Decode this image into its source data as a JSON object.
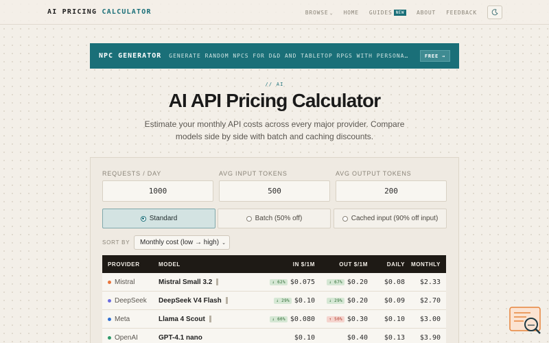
{
  "header": {
    "logo_main": "AI PRICING",
    "logo_accent": "CALCULATOR",
    "nav": {
      "browse": "BROWSE",
      "home": "HOME",
      "guides": "GUIDES",
      "guides_badge": "NEW",
      "about": "ABOUT",
      "feedback": "FEEDBACK"
    }
  },
  "banner": {
    "title": "NPC GENERATOR",
    "description": "GENERATE RANDOM NPCS FOR D&D AND TABLETOP RPGS WITH PERSONA…",
    "cta": "FREE →"
  },
  "hero": {
    "eyebrow": "// AI",
    "title": "AI API Pricing Calculator",
    "subtitle": "Estimate your monthly API costs across every major provider. Compare models side by side with batch and caching discounts."
  },
  "inputs": {
    "requests_label": "REQUESTS / DAY",
    "requests_value": "1000",
    "input_tokens_label": "AVG INPUT TOKENS",
    "input_tokens_value": "500",
    "output_tokens_label": "AVG OUTPUT TOKENS",
    "output_tokens_value": "200"
  },
  "modes": {
    "standard": "Standard",
    "batch": "Batch (50% off)",
    "cached": "Cached input (90% off input)",
    "selected": "standard"
  },
  "sort": {
    "label": "SORT BY",
    "selected": "Monthly cost (low → high)"
  },
  "table": {
    "headers": {
      "provider": "PROVIDER",
      "model": "MODEL",
      "in": "IN $/1M",
      "out": "OUT $/1M",
      "daily": "DAILY",
      "monthly": "MONTHLY"
    },
    "rows": [
      {
        "provider": "Mistral",
        "dot_color": "#e8743b",
        "model": "Mistral Small 3.2",
        "in_change": "↓ 62%",
        "in_dir": "down",
        "in": "$0.075",
        "out_change": "↓ 67%",
        "out_dir": "down",
        "out": "$0.20",
        "daily": "$0.08",
        "monthly": "$2.33"
      },
      {
        "provider": "DeepSeek",
        "dot_color": "#6b6be0",
        "model": "DeepSeek V4 Flash",
        "in_change": "↓ 29%",
        "in_dir": "down",
        "in": "$0.10",
        "out_change": "↓ 29%",
        "out_dir": "down",
        "out": "$0.20",
        "daily": "$0.09",
        "monthly": "$2.70"
      },
      {
        "provider": "Meta",
        "dot_color": "#2f6fd1",
        "model": "Llama 4 Scout",
        "in_change": "↓ 60%",
        "in_dir": "down",
        "in": "$0.080",
        "out_change": "↑ 50%",
        "out_dir": "up",
        "out": "$0.30",
        "daily": "$0.10",
        "monthly": "$3.00"
      },
      {
        "provider": "OpenAI",
        "dot_color": "#2f9a6a",
        "model": "GPT-4.1 nano",
        "in_change": "",
        "in_dir": "",
        "in": "$0.10",
        "out_change": "",
        "out_dir": "",
        "out": "$0.40",
        "daily": "$0.13",
        "monthly": "$3.90"
      }
    ]
  },
  "colors": {
    "accent": "#1a6f78",
    "background": "#f3efe8",
    "table_header": "#1e1a15"
  }
}
